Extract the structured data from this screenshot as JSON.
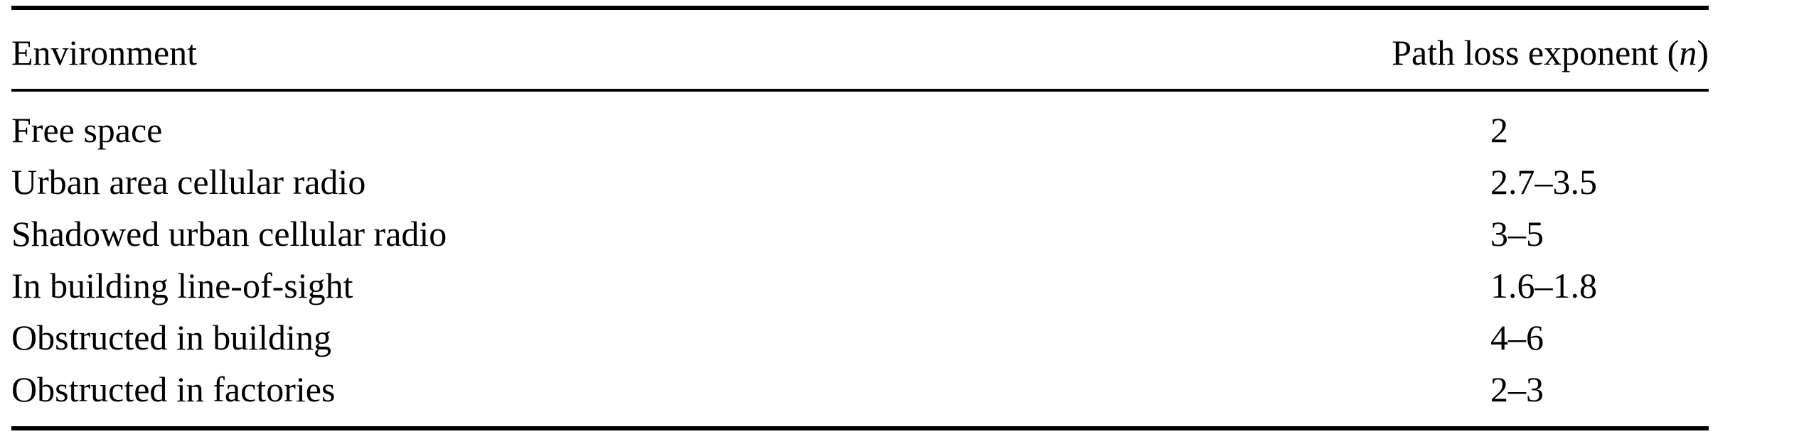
{
  "table": {
    "columns": {
      "environment": "Environment",
      "exponent_prefix": "Path loss exponent (",
      "exponent_var": "n",
      "exponent_suffix": ")"
    },
    "rows": [
      {
        "environment": "Free space",
        "exponent": "2"
      },
      {
        "environment": "Urban area cellular radio",
        "exponent": "2.7–3.5"
      },
      {
        "environment": "Shadowed urban cellular radio",
        "exponent": "3–5"
      },
      {
        "environment": "In building line-of-sight",
        "exponent": "1.6–1.8"
      },
      {
        "environment": "Obstructed in building",
        "exponent": "4–6"
      },
      {
        "environment": "Obstructed in factories",
        "exponent": "2–3"
      }
    ]
  }
}
